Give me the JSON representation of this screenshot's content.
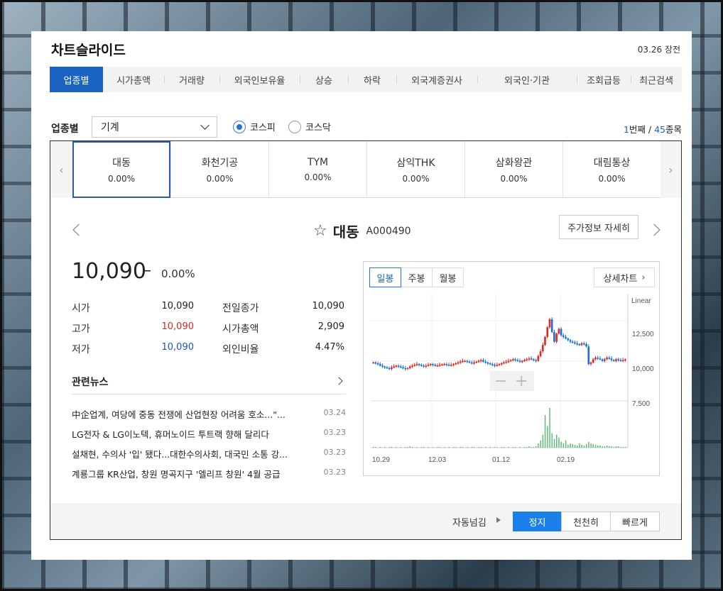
{
  "widget": {
    "title": "차트슬라이드",
    "market_time": "03.26 장전"
  },
  "tabs": [
    "업종별",
    "시가총액",
    "거래량",
    "외국인보유율",
    "상승",
    "하락",
    "외국계증권사",
    "외국인·기관",
    "조회급등",
    "최근검색"
  ],
  "filter": {
    "label": "업종별",
    "selected": "기계",
    "radio_kospi": "코스피",
    "radio_kosdaq": "코스닥",
    "page_current": "1",
    "page_current_suffix": "번째 / ",
    "page_total": "45",
    "page_total_suffix": "종목"
  },
  "carousel": [
    {
      "name": "대동",
      "rate": "0.00%"
    },
    {
      "name": "화천기공",
      "rate": "0.00%"
    },
    {
      "name": "TYM",
      "rate": "0.00%"
    },
    {
      "name": "삼익THK",
      "rate": "0.00%"
    },
    {
      "name": "삼화왕관",
      "rate": "0.00%"
    },
    {
      "name": "대림통상",
      "rate": "0.00%"
    }
  ],
  "stock": {
    "name": "대동",
    "code": "A000490",
    "detail_button": "주가정보 자세히",
    "price": "10,090",
    "change_symbol": "–",
    "change_rate": "0.00%",
    "stats": {
      "open_label": "시가",
      "open": "10,090",
      "high_label": "고가",
      "high": "10,090",
      "low_label": "저가",
      "low": "10,090",
      "prev_close_label": "전일종가",
      "prev_close": "10,090",
      "market_cap_label": "시가총액",
      "market_cap": "2,909",
      "foreign_ratio_label": "외인비율",
      "foreign_ratio": "4.47%"
    }
  },
  "news": {
    "title": "관련뉴스",
    "items": [
      {
        "headline": "中企업계, 여당에 중동 전쟁에 산업현장 어려움 호소...\"...",
        "date": "03.24"
      },
      {
        "headline": "LG전자 & LG이노텍, 휴머노이드 투트랙 향해 달리다",
        "date": "03.23"
      },
      {
        "headline": "설채현, 수의사 '입' 됐다...대한수의사회, 대국민 소통 강...",
        "date": "03.23"
      },
      {
        "headline": "계룡그룹 KR산업, 창원 명곡지구 '엘리프 창원' 4월 공급",
        "date": "03.23"
      }
    ]
  },
  "chart": {
    "periods": [
      "일봉",
      "주봉",
      "월봉"
    ],
    "detail_button": "상세차트",
    "scale_label": "Linear",
    "zoom_minus": "−",
    "zoom_plus": "+"
  },
  "chart_data": {
    "type": "candlestick",
    "y_ticks": [
      "12,500",
      "10,000",
      "7,500"
    ],
    "x_ticks": [
      "10.29",
      "12.03",
      "01.12",
      "02.19"
    ],
    "ylim": [
      7500,
      13800
    ],
    "colors": {
      "up": "#e0261e",
      "down": "#1a6fd8",
      "volume": "#54b96c"
    },
    "close": [
      9900,
      9850,
      9800,
      9700,
      9650,
      9600,
      9550,
      9500,
      9600,
      9650,
      9700,
      9650,
      9600,
      9550,
      9500,
      9550,
      9650,
      9700,
      9750,
      9800,
      9750,
      9700,
      9650,
      9700,
      9750,
      9800,
      9750,
      9700,
      9720,
      9750,
      9780,
      9800,
      9760,
      9720,
      9750,
      9800,
      9850,
      9900,
      9950,
      10000,
      10000,
      9950,
      9900,
      9850,
      9900,
      9950,
      10000,
      10050,
      9950,
      9900,
      9850,
      9800,
      9750,
      9700,
      9750,
      9800,
      9850,
      9900,
      9950,
      10000,
      10050,
      10100,
      10050,
      10000,
      9950,
      10000,
      10050,
      10100,
      10150,
      10100,
      10050,
      10000,
      10300,
      10600,
      11000,
      11500,
      12100,
      12600,
      11800,
      11200,
      11700,
      12000,
      11600,
      11500,
      11400,
      11300,
      11200,
      11150,
      11100,
      11050,
      11000,
      11100,
      11050,
      10900,
      9800,
      9900,
      10100,
      10200,
      10150,
      10100,
      10000,
      10100,
      10200,
      10150,
      10050,
      10000,
      10100,
      10050,
      10000,
      10050,
      10100
    ],
    "volume": [
      1,
      1,
      0,
      1,
      0,
      1,
      0,
      1,
      1,
      0,
      1,
      0,
      1,
      0,
      1,
      1,
      2,
      1,
      0,
      1,
      0,
      1,
      1,
      0,
      1,
      0,
      1,
      0,
      1,
      1,
      0,
      1,
      0,
      1,
      0,
      1,
      1,
      0,
      1,
      1,
      0,
      1,
      0,
      1,
      1,
      0,
      1,
      1,
      0,
      1,
      0,
      1,
      0,
      1,
      1,
      0,
      1,
      1,
      0,
      1,
      0,
      1,
      1,
      0,
      1,
      0,
      1,
      1,
      2,
      1,
      1,
      2,
      6,
      10,
      18,
      45,
      30,
      55,
      20,
      12,
      18,
      14,
      8,
      6,
      10,
      4,
      6,
      5,
      4,
      3,
      6,
      4,
      3,
      5,
      8,
      6,
      5,
      4,
      3,
      3,
      2,
      2,
      3,
      2,
      2,
      1,
      2,
      2,
      1,
      1,
      1
    ]
  },
  "autoplay": {
    "label": "자동넘김",
    "stop": "정지",
    "slow": "천천히",
    "fast": "빠르게"
  }
}
